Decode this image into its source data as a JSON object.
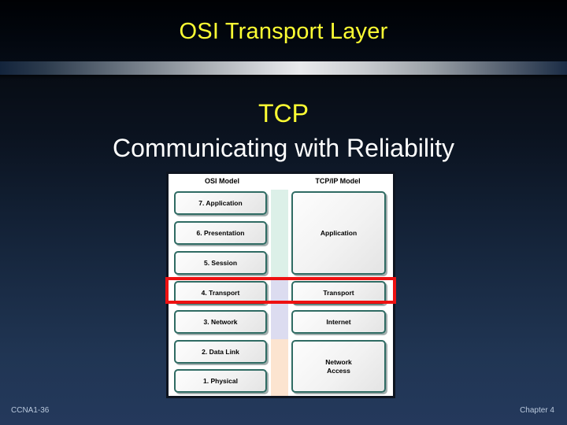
{
  "slide": {
    "title": "OSI Transport Layer",
    "heading_main": "TCP",
    "heading_sub": "Communicating with Reliability"
  },
  "colors": {
    "title_yellow": "#ffff33",
    "subtitle_white": "#ffffff",
    "highlight_red": "#ee1111",
    "box_border_teal": "#2f6b63",
    "band_green": "#dcf0e8",
    "band_lavender": "#dcdcf0",
    "band_peach": "#fce4d0",
    "footer_text": "#b9c8dc",
    "background_top": "#000104",
    "background_bottom": "#24395c"
  },
  "diagram": {
    "columns": {
      "osi_header": "OSI Model",
      "tcpip_header": "TCP/IP Model"
    },
    "osi_layers": [
      {
        "label": "7. Application"
      },
      {
        "label": "6. Presentation"
      },
      {
        "label": "5. Session"
      },
      {
        "label": "4. Transport"
      },
      {
        "label": "3. Network"
      },
      {
        "label": "2. Data Link"
      },
      {
        "label": "1. Physical"
      }
    ],
    "tcpip_layers": [
      {
        "label": "Application"
      },
      {
        "label": "Transport"
      },
      {
        "label": "Internet"
      },
      {
        "label": "Network\nAccess"
      }
    ],
    "highlighted_row": "Transport"
  },
  "footer": {
    "left": "CCNA1-36",
    "right": "Chapter 4"
  }
}
